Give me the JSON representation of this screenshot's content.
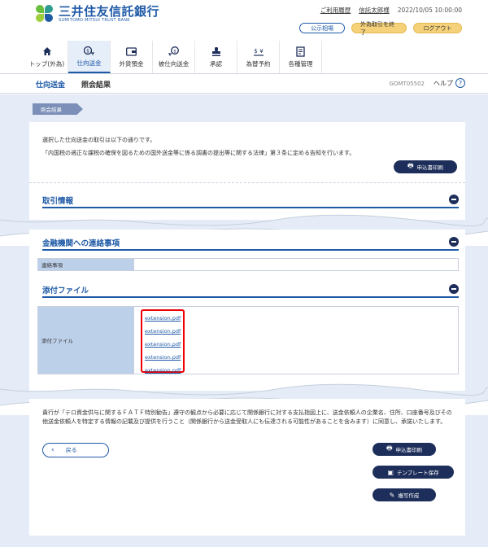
{
  "brand": {
    "name_jp": "三井住友信託銀行",
    "name_en": "SUMITOMO MITSUI TRUST BANK"
  },
  "header": {
    "links": [
      "ご利用履歴",
      "信託太郎様"
    ],
    "datetime": "2022/10/05 10:00:00",
    "buttons": {
      "public_cert": "公示相場",
      "foreign_end": "外為取引を終了",
      "logout": "ログアウト"
    }
  },
  "nav": {
    "items": [
      {
        "label": "トップ(外為)",
        "icon": "home-icon"
      },
      {
        "label": "仕向送金",
        "icon": "remittance-icon"
      },
      {
        "label": "外貨預金",
        "icon": "deposit-icon"
      },
      {
        "label": "被仕向送金",
        "icon": "incoming-remittance-icon"
      },
      {
        "label": "承認",
        "icon": "approval-icon"
      },
      {
        "label": "為替予約",
        "icon": "fx-reservation-icon"
      },
      {
        "label": "各種管理",
        "icon": "management-icon"
      }
    ],
    "active_index": 1
  },
  "titlebar": {
    "crumb": "仕向送金",
    "title": "照会結果",
    "screen_code": "GOMT05502",
    "help": "ヘルプ"
  },
  "step": "照会結果",
  "intro": {
    "line1": "選択した仕向送金の取引は以下の通りです。",
    "line2": "「内国税の適正な課税の確保を図るための国外送金等に係る調書の提出等に関する法律」第３条に定める告知を行います。",
    "print_button": "申込書印刷"
  },
  "sections": {
    "transaction": "取引情報",
    "bank_contact": "金融機関への連絡事項",
    "contact_label": "連絡事項",
    "contact_value": "",
    "attachments": "添付ファイル",
    "attachment_label": "添付ファイル",
    "files": [
      "extension.pdf",
      "extension.pdf",
      "extension.pdf",
      "extension.pdf",
      "extension.pdf"
    ]
  },
  "footer": {
    "note": "貴行が「テロ資金供与に関するＦＡＴＦ特別勧告」遵守の観点から必要に応じて関係銀行に対する支払指図上に、送金依頼人の企業名、住所、口座番号及びその他送金依頼人を特定する情報の記載及び提供を行うこと（関係銀行から送金受取人にも伝達される可能性があることを含みます）に同意し、承諾いたします。",
    "back": "戻る",
    "print": "申込書印刷",
    "template_save": "テンプレート保存",
    "copy_create": "複写作成"
  },
  "colors": {
    "brand_blue": "#1f5aa6",
    "navy": "#1d2e5a",
    "page_bg": "#e5ecf7",
    "highlight": "#e00000"
  }
}
